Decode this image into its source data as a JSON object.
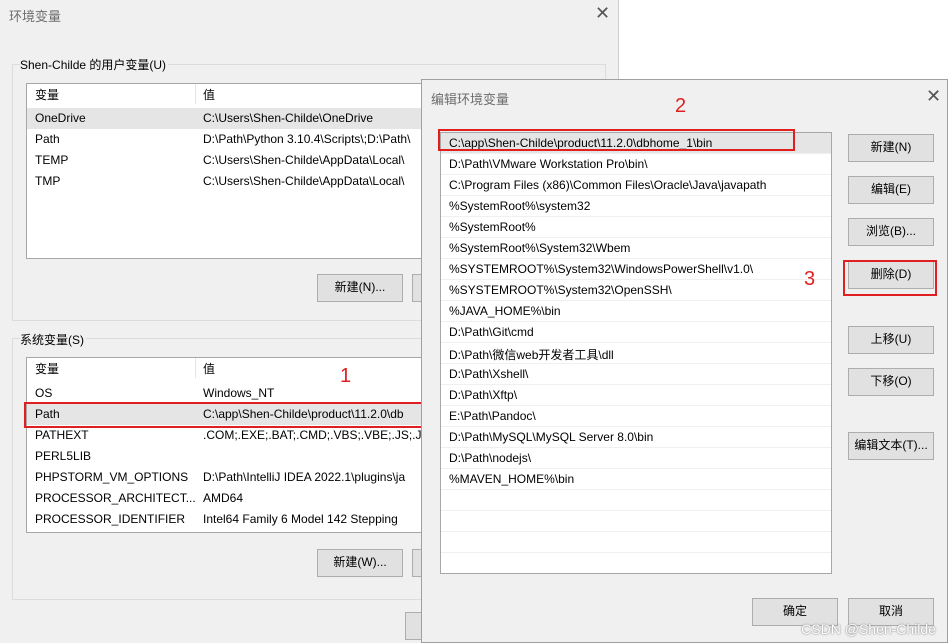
{
  "back_dialog": {
    "title": "环境变量",
    "user_group_label": "Shen-Childe 的用户变量(U)",
    "user_vars": {
      "headers": [
        "变量",
        "值"
      ],
      "rows": [
        {
          "name": "OneDrive",
          "value": "C:\\Users\\Shen-Childe\\OneDrive"
        },
        {
          "name": "Path",
          "value": "D:\\Path\\Python 3.10.4\\Scripts\\;D:\\Path\\"
        },
        {
          "name": "TEMP",
          "value": "C:\\Users\\Shen-Childe\\AppData\\Local\\"
        },
        {
          "name": "TMP",
          "value": "C:\\Users\\Shen-Childe\\AppData\\Local\\"
        }
      ]
    },
    "user_new_button": "新建(N)...",
    "system_group_label": "系统变量(S)",
    "system_vars": {
      "headers": [
        "变量",
        "值"
      ],
      "rows": [
        {
          "name": "OS",
          "value": "Windows_NT"
        },
        {
          "name": "Path",
          "value": "C:\\app\\Shen-Childe\\product\\11.2.0\\db"
        },
        {
          "name": "PATHEXT",
          "value": ".COM;.EXE;.BAT;.CMD;.VBS;.VBE;.JS;.JS"
        },
        {
          "name": "PERL5LIB",
          "value": ""
        },
        {
          "name": "PHPSTORM_VM_OPTIONS",
          "value": "D:\\Path\\IntelliJ IDEA 2022.1\\plugins\\ja"
        },
        {
          "name": "PROCESSOR_ARCHITECT...",
          "value": "AMD64"
        },
        {
          "name": "PROCESSOR_IDENTIFIER",
          "value": "Intel64 Family 6 Model 142 Stepping"
        }
      ]
    },
    "system_new_button": "新建(W)..."
  },
  "front_dialog": {
    "title": "编辑环境变量",
    "paths": [
      "C:\\app\\Shen-Childe\\product\\11.2.0\\dbhome_1\\bin",
      "D:\\Path\\VMware Workstation Pro\\bin\\",
      "C:\\Program Files (x86)\\Common Files\\Oracle\\Java\\javapath",
      "%SystemRoot%\\system32",
      "%SystemRoot%",
      "%SystemRoot%\\System32\\Wbem",
      "%SYSTEMROOT%\\System32\\WindowsPowerShell\\v1.0\\",
      "%SYSTEMROOT%\\System32\\OpenSSH\\",
      "%JAVA_HOME%\\bin",
      "D:\\Path\\Git\\cmd",
      "D:\\Path\\微信web开发者工具\\dll",
      "D:\\Path\\Xshell\\",
      "D:\\Path\\Xftp\\",
      "E:\\Path\\Pandoc\\",
      "D:\\Path\\MySQL\\MySQL Server 8.0\\bin",
      "D:\\Path\\nodejs\\",
      "%MAVEN_HOME%\\bin"
    ],
    "buttons": {
      "new": "新建(N)",
      "edit": "编辑(E)",
      "browse": "浏览(B)...",
      "delete": "删除(D)",
      "move_up": "上移(U)",
      "move_down": "下移(O)",
      "edit_text": "编辑文本(T)..."
    },
    "ok": "确定",
    "cancel": "取消"
  },
  "annotations": {
    "one": "1",
    "two": "2",
    "three": "3"
  },
  "watermark": "CSDN @Shen-Childe",
  "colors": {
    "annotation_red": "#e02020",
    "selection_gray": "#e5e5e5"
  }
}
